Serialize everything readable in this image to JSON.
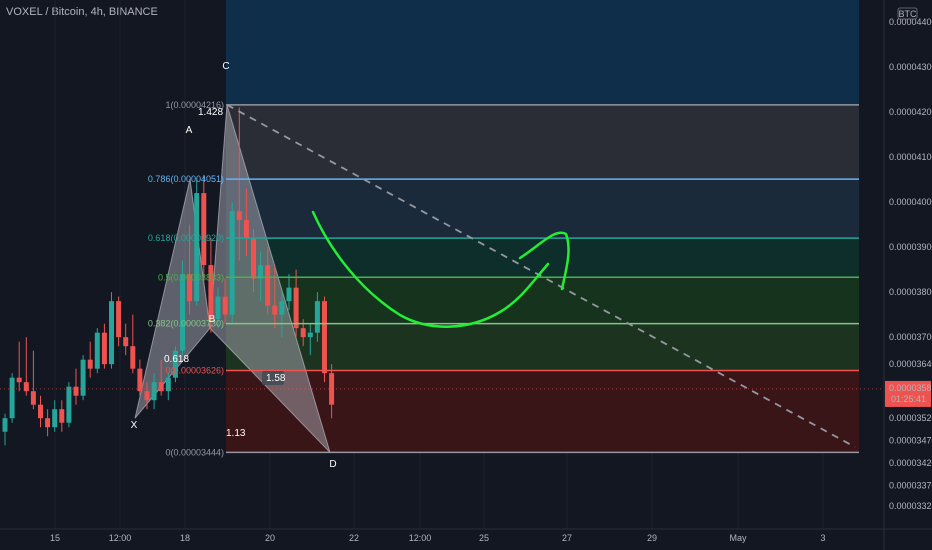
{
  "header": {
    "title": "VOXEL / Bitcoin, 4h, BINANCE"
  },
  "currency_badge": "BTC",
  "last_price": {
    "value": "0.00003585",
    "countdown": "01:25:41",
    "color": "#ef5350"
  },
  "chart_data": {
    "type": "candlestick",
    "title": "VOXEL / Bitcoin, 4h, BINANCE",
    "ylim": [
      3.305e-05,
      4.44e-05
    ],
    "x_ticks": [
      "15",
      "12:00",
      "18",
      "20",
      "22",
      "12:00",
      "25",
      "27",
      "29",
      "May",
      "3"
    ],
    "y_ticks": [
      {
        "label": "0.00004400",
        "value": 4.4e-05
      },
      {
        "label": "0.00004300",
        "value": 4.3e-05
      },
      {
        "label": "0.00004200",
        "value": 4.2e-05
      },
      {
        "label": "0.00004100",
        "value": 4.1e-05
      },
      {
        "label": "0.00004000",
        "value": 4e-05
      },
      {
        "label": "0.00003900",
        "value": 3.9e-05
      },
      {
        "label": "0.00003800",
        "value": 3.8e-05
      },
      {
        "label": "0.00003700",
        "value": 3.7e-05
      },
      {
        "label": "0.00003640",
        "value": 3.64e-05
      },
      {
        "label": "0.00003520",
        "value": 3.52e-05
      },
      {
        "label": "0.00003470",
        "value": 3.47e-05
      },
      {
        "label": "0.00003420",
        "value": 3.42e-05
      },
      {
        "label": "0.00003370",
        "value": 3.37e-05
      },
      {
        "label": "0.00003325",
        "value": 3.325e-05
      }
    ],
    "fib_levels": [
      {
        "label": "1(0.00004216)",
        "value": 4.216e-05,
        "color": "#9598a1",
        "zone": "#2a2d35"
      },
      {
        "label": "0.786(0.00004051)",
        "value": 4.051e-05,
        "color": "#64b5f6",
        "zone": "#1b2a3a"
      },
      {
        "label": "0.618(0.00003920)",
        "value": 3.92e-05,
        "color": "#26a69a",
        "zone": "#0e2e2b"
      },
      {
        "label": "0.5(0.00003833)",
        "value": 3.833e-05,
        "color": "#4caf50",
        "zone": "#16331e"
      },
      {
        "label": "0.382(0.00003730)",
        "value": 3.73e-05,
        "color": "#81c784",
        "zone": "#1c3320"
      },
      {
        "label": "0(0.00003626)",
        "value": 3.626e-05,
        "color": "#ef5350",
        "zone": "#3a1518"
      },
      {
        "label": "0(0.00003444)",
        "value": 3.444e-05,
        "color": "#9598a1",
        "zone": null
      }
    ],
    "top_zone_color": "#0f2e4a",
    "pattern_points": [
      {
        "label": "X",
        "value": 3.52e-05
      },
      {
        "label": "A",
        "value": 4.051e-05
      },
      {
        "label": "B",
        "value": 3.72e-05
      },
      {
        "label": "C",
        "value": 4.216e-05
      },
      {
        "label": "D",
        "value": 3.444e-05
      }
    ],
    "pattern_ratios": [
      "1.428",
      "0.618",
      "1.58",
      "1.13"
    ],
    "candles": [
      {
        "o": 3.49e-05,
        "h": 3.53e-05,
        "l": 3.46e-05,
        "c": 3.52e-05
      },
      {
        "o": 3.52e-05,
        "h": 3.62e-05,
        "l": 3.51e-05,
        "c": 3.61e-05
      },
      {
        "o": 3.61e-05,
        "h": 3.69e-05,
        "l": 3.58e-05,
        "c": 3.6e-05
      },
      {
        "o": 3.6e-05,
        "h": 3.7e-05,
        "l": 3.57e-05,
        "c": 3.58e-05
      },
      {
        "o": 3.58e-05,
        "h": 3.67e-05,
        "l": 3.54e-05,
        "c": 3.55e-05
      },
      {
        "o": 3.55e-05,
        "h": 3.57e-05,
        "l": 3.5e-05,
        "c": 3.52e-05
      },
      {
        "o": 3.52e-05,
        "h": 3.54e-05,
        "l": 3.48e-05,
        "c": 3.5e-05
      },
      {
        "o": 3.5e-05,
        "h": 3.56e-05,
        "l": 3.49e-05,
        "c": 3.54e-05
      },
      {
        "o": 3.54e-05,
        "h": 3.56e-05,
        "l": 3.49e-05,
        "c": 3.51e-05
      },
      {
        "o": 3.51e-05,
        "h": 3.6e-05,
        "l": 3.5e-05,
        "c": 3.59e-05
      },
      {
        "o": 3.59e-05,
        "h": 3.63e-05,
        "l": 3.55e-05,
        "c": 3.57e-05
      },
      {
        "o": 3.57e-05,
        "h": 3.66e-05,
        "l": 3.56e-05,
        "c": 3.65e-05
      },
      {
        "o": 3.65e-05,
        "h": 3.69e-05,
        "l": 3.61e-05,
        "c": 3.63e-05
      },
      {
        "o": 3.63e-05,
        "h": 3.72e-05,
        "l": 3.62e-05,
        "c": 3.71e-05
      },
      {
        "o": 3.71e-05,
        "h": 3.73e-05,
        "l": 3.63e-05,
        "c": 3.64e-05
      },
      {
        "o": 3.64e-05,
        "h": 3.8e-05,
        "l": 3.63e-05,
        "c": 3.78e-05
      },
      {
        "o": 3.78e-05,
        "h": 3.79e-05,
        "l": 3.68e-05,
        "c": 3.7e-05
      },
      {
        "o": 3.7e-05,
        "h": 3.73e-05,
        "l": 3.66e-05,
        "c": 3.68e-05
      },
      {
        "o": 3.68e-05,
        "h": 3.75e-05,
        "l": 3.62e-05,
        "c": 3.63e-05
      },
      {
        "o": 3.63e-05,
        "h": 3.65e-05,
        "l": 3.57e-05,
        "c": 3.58e-05
      },
      {
        "o": 3.58e-05,
        "h": 3.6e-05,
        "l": 3.54e-05,
        "c": 3.56e-05
      },
      {
        "o": 3.56e-05,
        "h": 3.62e-05,
        "l": 3.54e-05,
        "c": 3.6e-05
      },
      {
        "o": 3.6e-05,
        "h": 3.65e-05,
        "l": 3.57e-05,
        "c": 3.58e-05
      },
      {
        "o": 3.58e-05,
        "h": 3.62e-05,
        "l": 3.56e-05,
        "c": 3.61e-05
      },
      {
        "o": 3.61e-05,
        "h": 3.68e-05,
        "l": 3.6e-05,
        "c": 3.67e-05
      },
      {
        "o": 3.67e-05,
        "h": 3.87e-05,
        "l": 3.66e-05,
        "c": 3.84e-05
      },
      {
        "o": 3.84e-05,
        "h": 3.95e-05,
        "l": 3.75e-05,
        "c": 3.78e-05
      },
      {
        "o": 3.78e-05,
        "h": 4.05e-05,
        "l": 3.77e-05,
        "c": 4.02e-05
      },
      {
        "o": 4.02e-05,
        "h": 4.06e-05,
        "l": 3.83e-05,
        "c": 3.86e-05
      },
      {
        "o": 3.86e-05,
        "h": 3.92e-05,
        "l": 3.71e-05,
        "c": 3.74e-05
      },
      {
        "o": 3.74e-05,
        "h": 3.81e-05,
        "l": 3.72e-05,
        "c": 3.79e-05
      },
      {
        "o": 3.79e-05,
        "h": 3.83e-05,
        "l": 3.73e-05,
        "c": 3.75e-05
      },
      {
        "o": 3.75e-05,
        "h": 4e-05,
        "l": 3.73e-05,
        "c": 3.98e-05
      },
      {
        "o": 3.98e-05,
        "h": 4.21e-05,
        "l": 3.87e-05,
        "c": 3.96e-05
      },
      {
        "o": 3.96e-05,
        "h": 4.03e-05,
        "l": 3.88e-05,
        "c": 3.92e-05
      },
      {
        "o": 3.92e-05,
        "h": 3.94e-05,
        "l": 3.8e-05,
        "c": 3.83e-05
      },
      {
        "o": 3.83e-05,
        "h": 3.89e-05,
        "l": 3.78e-05,
        "c": 3.86e-05
      },
      {
        "o": 3.86e-05,
        "h": 3.9e-05,
        "l": 3.75e-05,
        "c": 3.77e-05
      },
      {
        "o": 3.77e-05,
        "h": 3.86e-05,
        "l": 3.72e-05,
        "c": 3.75e-05
      },
      {
        "o": 3.75e-05,
        "h": 3.8e-05,
        "l": 3.7e-05,
        "c": 3.78e-05
      },
      {
        "o": 3.78e-05,
        "h": 3.84e-05,
        "l": 3.76e-05,
        "c": 3.81e-05
      },
      {
        "o": 3.81e-05,
        "h": 3.85e-05,
        "l": 3.7e-05,
        "c": 3.72e-05
      },
      {
        "o": 3.72e-05,
        "h": 3.74e-05,
        "l": 3.68e-05,
        "c": 3.7e-05
      },
      {
        "o": 3.7e-05,
        "h": 3.73e-05,
        "l": 3.66e-05,
        "c": 3.71e-05
      },
      {
        "o": 3.71e-05,
        "h": 3.8e-05,
        "l": 3.69e-05,
        "c": 3.78e-05
      },
      {
        "o": 3.78e-05,
        "h": 3.79e-05,
        "l": 3.6e-05,
        "c": 3.62e-05
      },
      {
        "o": 3.62e-05,
        "h": 3.64e-05,
        "l": 3.52e-05,
        "c": 3.55e-05
      }
    ]
  }
}
